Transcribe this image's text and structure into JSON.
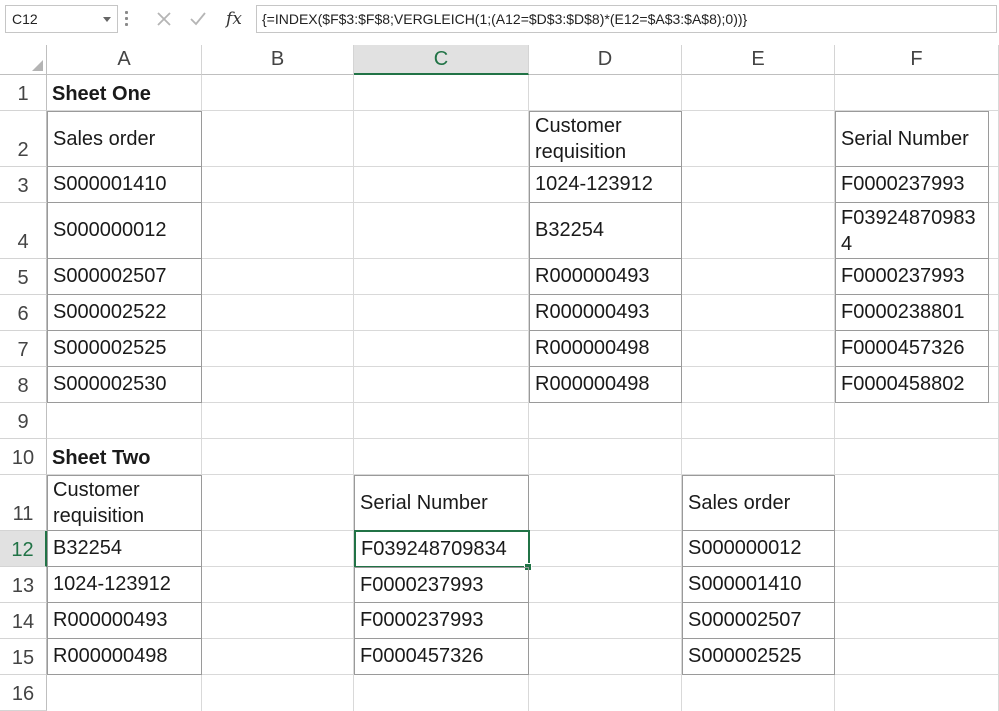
{
  "formula_bar": {
    "name_box": "C12",
    "fx_label": "fx",
    "formula": "{=INDEX($F$3:$F$8;VERGLEICH(1;(A12=$D$3:$D$8)*(E12=$A$3:$A$8);0))}"
  },
  "columns": [
    "A",
    "B",
    "C",
    "D",
    "E",
    "F"
  ],
  "rows": [
    "1",
    "2",
    "3",
    "4",
    "5",
    "6",
    "7",
    "8",
    "9",
    "10",
    "11",
    "12",
    "13",
    "14",
    "15",
    "16"
  ],
  "sheet_one": {
    "title": "Sheet One",
    "sales_header": "Sales order",
    "sales_orders": [
      "S000001410",
      "S000000012",
      "S000002507",
      "S000002522",
      "S000002525",
      "S000002530"
    ],
    "req_header": "Customer requisition",
    "requisitions": [
      "1024-123912",
      "B32254",
      "R000000493",
      "R000000493",
      "R000000498",
      "R000000498"
    ],
    "serial_header": "Serial Number",
    "serials": [
      "F0000237993",
      "F039248709834",
      "F0000237993",
      "F0000238801",
      "F0000457326",
      "F0000458802"
    ]
  },
  "sheet_two": {
    "title": "Sheet Two",
    "req_header": "Customer requisition",
    "requisitions": [
      "B32254",
      "1024-123912",
      "R000000493",
      "R000000498"
    ],
    "serial_header": "Serial Number",
    "serials": [
      "F039248709834",
      "F0000237993",
      "F0000237993",
      "F0000457326"
    ],
    "sales_header": "Sales order",
    "sales_orders": [
      "S000000012",
      "S000001410",
      "S000002507",
      "S000002525"
    ]
  },
  "selection": {
    "cell": "C12",
    "accent_color": "#217346"
  }
}
